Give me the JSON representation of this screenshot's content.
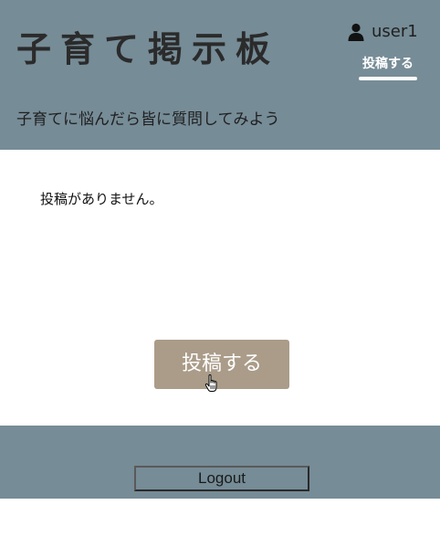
{
  "header": {
    "site_title": "子育て掲示板",
    "subtitle": "子育てに悩んだら皆に質問してみよう",
    "user_icon": "user-icon",
    "user_name": "user1",
    "post_link_label": "投稿する"
  },
  "main": {
    "empty_message": "投稿がありません。",
    "post_button_label": "投稿する"
  },
  "footer": {
    "logout_label": "Logout"
  },
  "colors": {
    "header_bg": "#768c97",
    "post_button_bg": "#aa9c89",
    "link_text": "#ffffff",
    "title_text": "#2b2b2b"
  }
}
